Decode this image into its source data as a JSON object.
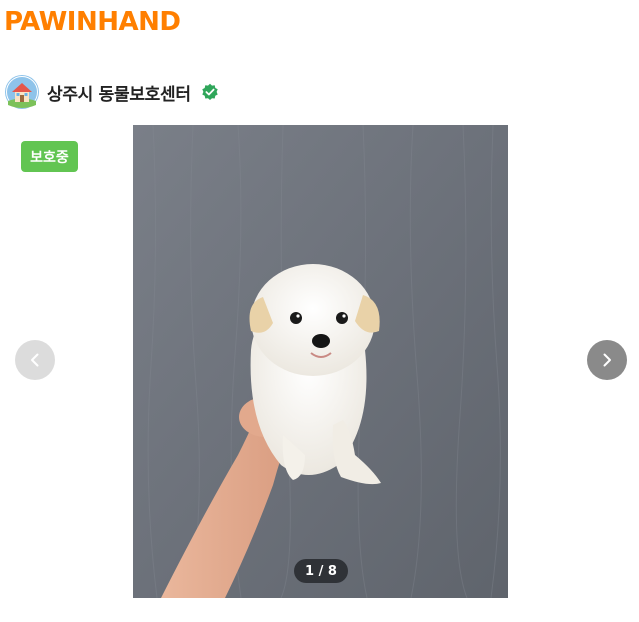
{
  "brand": {
    "logo_text": "PAWINHAND",
    "color": "#ff7f00"
  },
  "shelter": {
    "name": "상주시 동물보호센터",
    "avatar_icon": "shelter-house-icon",
    "verified_icon": "verified-badge-icon",
    "verified_color": "#2fa65a"
  },
  "status_badge": {
    "label": "보호중",
    "color": "#62c552"
  },
  "gallery": {
    "current": 1,
    "total": 8,
    "counter_text": "1 / 8",
    "counter_bg": "#2f3237",
    "prev_icon": "chevron-left-icon",
    "next_icon": "chevron-right-icon",
    "prev_bg": "#dcdcdc",
    "next_bg": "#8a8a8a"
  }
}
